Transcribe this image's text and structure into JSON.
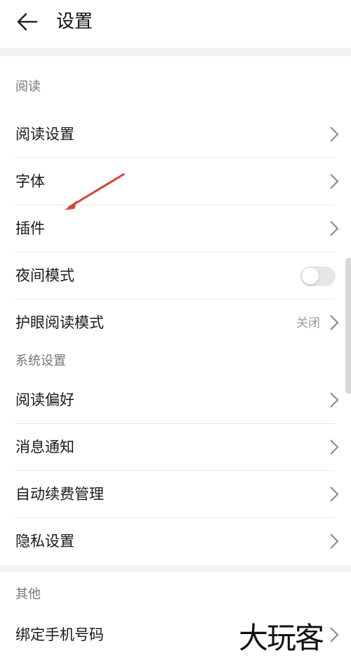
{
  "header": {
    "title": "设置",
    "back_icon": "arrow-left-icon"
  },
  "sections": [
    {
      "title": "阅读",
      "items": [
        {
          "label": "阅读设置",
          "control": "chevron"
        },
        {
          "label": "字体",
          "control": "chevron"
        },
        {
          "label": "插件",
          "control": "chevron"
        },
        {
          "label": "夜间模式",
          "control": "toggle",
          "toggle_on": false
        },
        {
          "label": "护眼阅读模式",
          "control": "chevron",
          "value": "关闭"
        }
      ]
    },
    {
      "title": "系统设置",
      "items": [
        {
          "label": "阅读偏好",
          "control": "chevron"
        },
        {
          "label": "消息通知",
          "control": "chevron"
        },
        {
          "label": "自动续费管理",
          "control": "chevron"
        },
        {
          "label": "隐私设置",
          "control": "chevron"
        }
      ]
    },
    {
      "title": "其他",
      "items": [
        {
          "label": "绑定手机号码",
          "control": "chevron"
        }
      ]
    }
  ],
  "annotation": {
    "arrow_color": "#d9413a",
    "points_to": "插件"
  },
  "watermark": "大玩客",
  "colors": {
    "background": "#f2f2f2",
    "surface": "#ffffff",
    "secondary_text": "#777777",
    "divider": "#e8e8e8"
  }
}
